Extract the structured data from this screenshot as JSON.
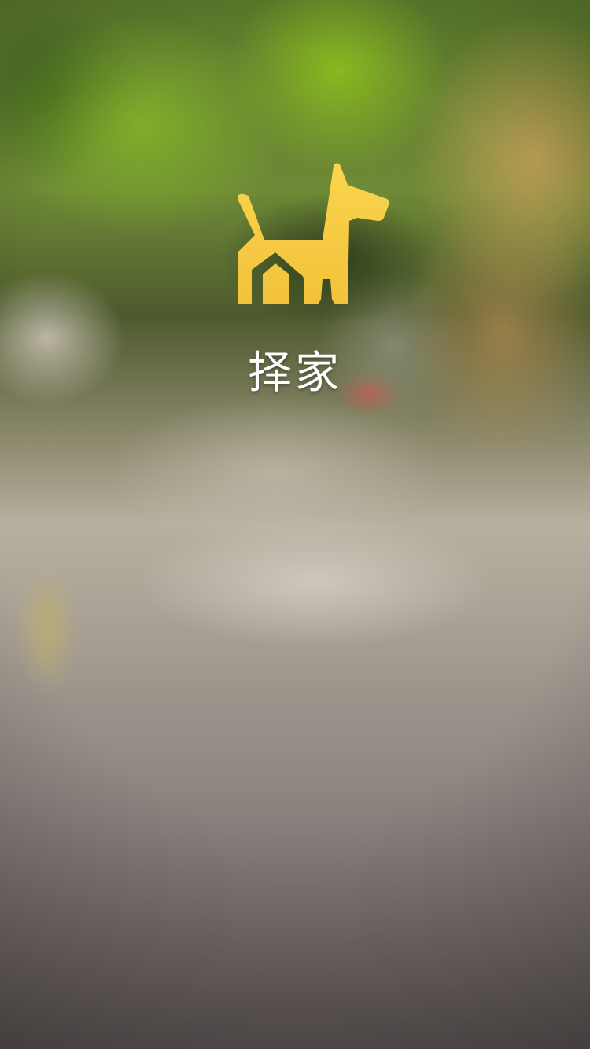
{
  "splash": {
    "app_name": "择家",
    "logo_icon": "dog-house-icon",
    "logo_color_top": "#fad54e",
    "logo_color_bottom": "#f2c23a",
    "text_color": "#ffffff"
  }
}
